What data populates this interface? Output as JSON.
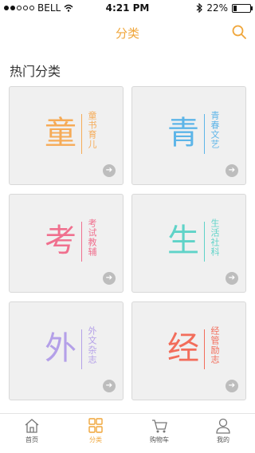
{
  "status": {
    "carrier": "BELL",
    "time": "4:21 PM",
    "battery": "22%",
    "battery_level": 0.22
  },
  "nav": {
    "title": "分类"
  },
  "section": {
    "title": "热门分类"
  },
  "categories": [
    {
      "glyph": "童",
      "subtitle": "童书育儿",
      "color": "#f6ab57"
    },
    {
      "glyph": "青",
      "subtitle": "青春文艺",
      "color": "#5db5e8"
    },
    {
      "glyph": "考",
      "subtitle": "考试教辅",
      "color": "#f0708e"
    },
    {
      "glyph": "生",
      "subtitle": "生活社科",
      "color": "#5fd3c8"
    },
    {
      "glyph": "外",
      "subtitle": "外文杂志",
      "color": "#b4a0e8"
    },
    {
      "glyph": "经",
      "subtitle": "经管励志",
      "color": "#f26d5b"
    }
  ],
  "tabs": [
    {
      "label": "首页",
      "icon": "home-icon"
    },
    {
      "label": "分类",
      "icon": "grid-icon",
      "active": true
    },
    {
      "label": "购物车",
      "icon": "cart-icon"
    },
    {
      "label": "我的",
      "icon": "user-icon"
    }
  ],
  "colors": {
    "accent": "#f0a63a"
  }
}
